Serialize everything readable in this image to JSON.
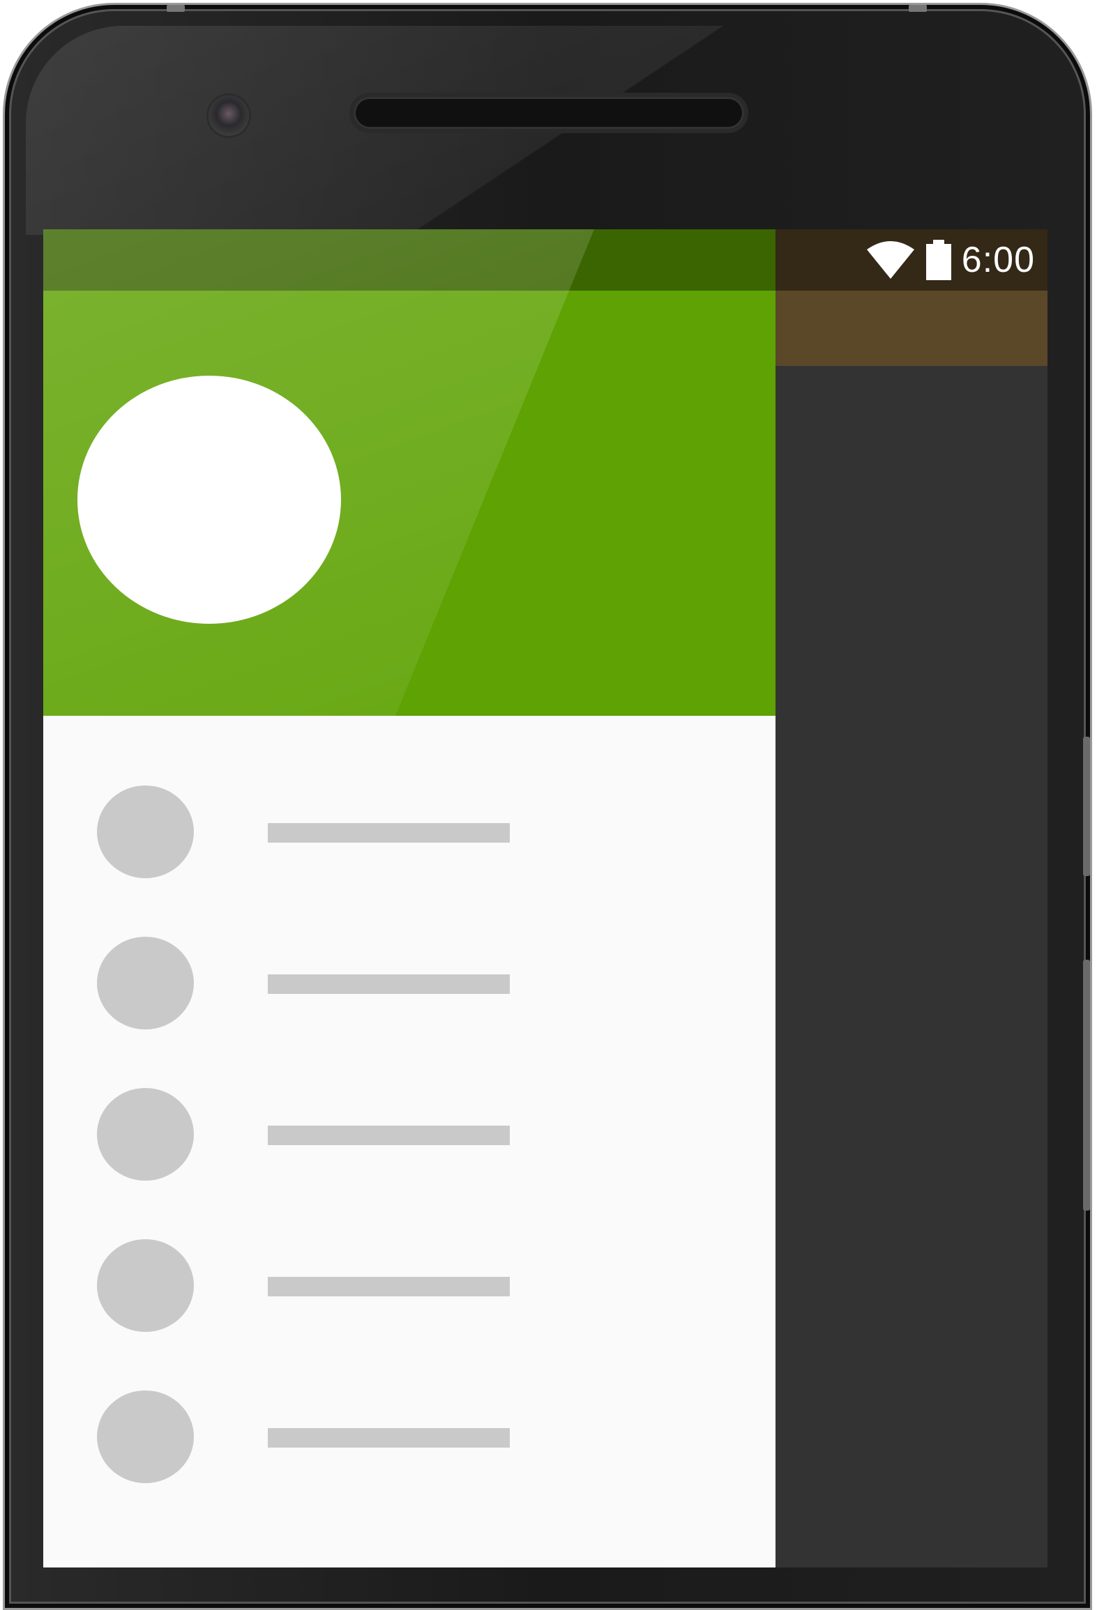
{
  "status_bar": {
    "time": "6:00",
    "icons": [
      "wifi-icon",
      "battery-icon"
    ]
  },
  "drawer": {
    "header": {
      "avatar": "avatar-placeholder",
      "color": "#5ea203",
      "status_color": "#3a6500"
    },
    "items_count": 5,
    "item_placeholder_color": "#c9c9c9",
    "background": "#fafafa"
  },
  "scrim": {
    "status_color": "#342817",
    "appbar_color": "#5b4828",
    "content_color": "#333333"
  }
}
